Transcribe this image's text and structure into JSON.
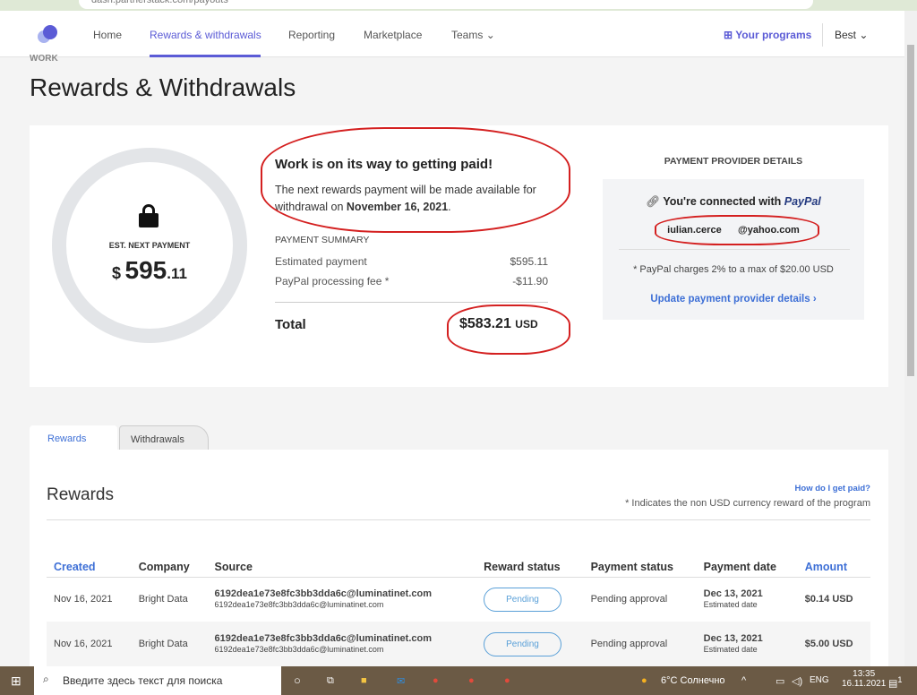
{
  "browser": {
    "url": "dash.partnerstack.com/payouts"
  },
  "nav": {
    "items": [
      "Home",
      "Rewards & withdrawals",
      "Reporting",
      "Marketplace",
      "Teams"
    ],
    "active": "Rewards & withdrawals",
    "programs": "Your programs",
    "account": "Best",
    "accent": "#5b5bd6"
  },
  "page": {
    "eyebrow": "WORK",
    "title": "Rewards & Withdrawals"
  },
  "summary": {
    "est_label": "EST. NEXT PAYMENT",
    "est_dollar": "$",
    "est_whole": "595",
    "est_cents": ".11",
    "headline": "Work is on its way to getting paid!",
    "message_prefix": "The next rewards payment will be made available for withdrawal on ",
    "message_date": "November 16, 2021",
    "message_suffix": ".",
    "summary_title": "PAYMENT SUMMARY",
    "lines": [
      {
        "label": "Estimated payment",
        "value": "$595.11"
      },
      {
        "label": "PayPal processing fee *",
        "value": "-$11.90"
      }
    ],
    "total_label": "Total",
    "total_value": "$583.21",
    "total_currency": "USD"
  },
  "provider": {
    "title": "PAYMENT PROVIDER DETAILS",
    "connected": "You're connected with",
    "brand": "PayPal",
    "email_left": "iulian.cerce",
    "email_right": "@yahoo.com",
    "note": "* PayPal charges 2% to a max of $20.00 USD",
    "update": "Update payment provider details ›"
  },
  "tabs": [
    "Rewards",
    "Withdrawals"
  ],
  "rewards": {
    "title": "Rewards",
    "help": "How do I get paid?",
    "note": "* Indicates the non USD currency reward of the program",
    "columns": [
      "Created",
      "Company",
      "Source",
      "Reward status",
      "Payment status",
      "Payment date",
      "Amount"
    ],
    "rows": [
      {
        "created": "Nov 16, 2021",
        "company": "Bright Data",
        "source": "6192dea1e73e8fc3bb3dda6c@luminatinet.com",
        "source_sub": "6192dea1e73e8fc3bb3dda6c@luminatinet.com",
        "reward_status": "Pending",
        "payment_status": "Pending approval",
        "date": "Dec 13, 2021",
        "date_sub": "Estimated date",
        "amount": "$0.14 USD"
      },
      {
        "created": "Nov 16, 2021",
        "company": "Bright Data",
        "source": "6192dea1e73e8fc3bb3dda6c@luminatinet.com",
        "source_sub": "6192dea1e73e8fc3bb3dda6c@luminatinet.com",
        "reward_status": "Pending",
        "payment_status": "Pending approval",
        "date": "Dec 13, 2021",
        "date_sub": "Estimated date",
        "amount": "$5.00 USD"
      }
    ]
  },
  "taskbar": {
    "search": "Введите здесь текст для поиска",
    "weather": "6°C Солнечно",
    "lang": "ENG",
    "time": "13:35",
    "date": "16.11.2021",
    "notifications": "1"
  }
}
